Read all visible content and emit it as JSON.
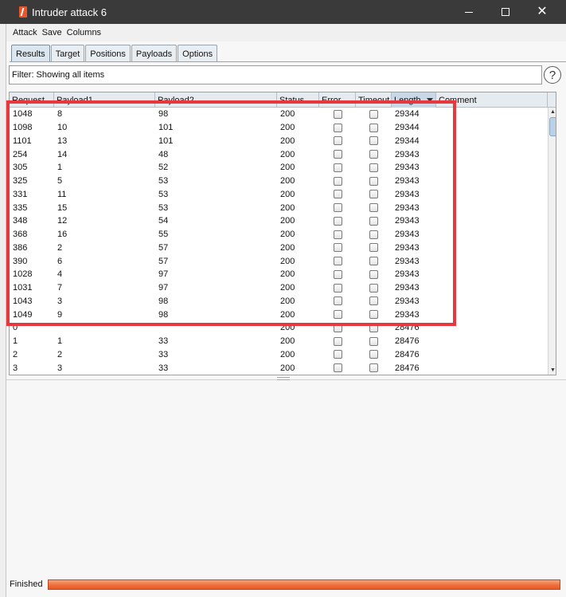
{
  "window": {
    "title": "Intruder attack 6"
  },
  "menu": [
    "Attack",
    "Save",
    "Columns"
  ],
  "tabs": [
    {
      "label": "Results",
      "active": true
    },
    {
      "label": "Target",
      "active": false
    },
    {
      "label": "Positions",
      "active": false
    },
    {
      "label": "Payloads",
      "active": false
    },
    {
      "label": "Options",
      "active": false
    }
  ],
  "filter": {
    "text": "Filter: Showing all items"
  },
  "table": {
    "columns": [
      "Request",
      "Payload1",
      "Payload2",
      "Status",
      "Error",
      "Timeout",
      "Length",
      "Comment"
    ],
    "sorted_column": "Length",
    "rows": [
      [
        "1048",
        "8",
        "98",
        "200",
        "29344"
      ],
      [
        "1098",
        "10",
        "101",
        "200",
        "29344"
      ],
      [
        "1101",
        "13",
        "101",
        "200",
        "29344"
      ],
      [
        "254",
        "14",
        "48",
        "200",
        "29343"
      ],
      [
        "305",
        "1",
        "52",
        "200",
        "29343"
      ],
      [
        "325",
        "5",
        "53",
        "200",
        "29343"
      ],
      [
        "331",
        "11",
        "53",
        "200",
        "29343"
      ],
      [
        "335",
        "15",
        "53",
        "200",
        "29343"
      ],
      [
        "348",
        "12",
        "54",
        "200",
        "29343"
      ],
      [
        "368",
        "16",
        "55",
        "200",
        "29343"
      ],
      [
        "386",
        "2",
        "57",
        "200",
        "29343"
      ],
      [
        "390",
        "6",
        "57",
        "200",
        "29343"
      ],
      [
        "1028",
        "4",
        "97",
        "200",
        "29343"
      ],
      [
        "1031",
        "7",
        "97",
        "200",
        "29343"
      ],
      [
        "1043",
        "3",
        "98",
        "200",
        "29343"
      ],
      [
        "1049",
        "9",
        "98",
        "200",
        "29343"
      ],
      [
        "0",
        "",
        "",
        "200",
        "28476"
      ],
      [
        "1",
        "1",
        "33",
        "200",
        "28476"
      ],
      [
        "2",
        "2",
        "33",
        "200",
        "28476"
      ],
      [
        "3",
        "3",
        "33",
        "200",
        "28476"
      ]
    ]
  },
  "status": {
    "text": "Finished",
    "progress_percent": 100
  },
  "colors": {
    "highlight": "#e8383d",
    "progress": "#ef6f3c",
    "titlebar": "#3a3a3a"
  }
}
